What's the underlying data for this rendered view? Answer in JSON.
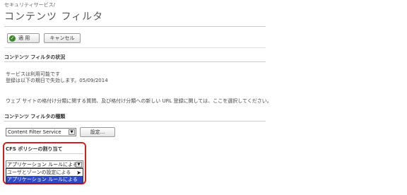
{
  "breadcrumb": "セキュリティサービス/",
  "page_title": "コンテンツ フィルタ",
  "toolbar": {
    "apply_label": "適 用",
    "cancel_label": "キャンセル"
  },
  "status_section": {
    "header": "コンテンツ フィルタの状況",
    "line1": "サービスは利用可能です",
    "line2": "登録は以下の期日で失効します。05/09/2014",
    "info_link": "ウェブ サイトの格付け分類に関する質問、及び格付け分類への新しい URL 登録に関しては、ここを選択してください。"
  },
  "type_section": {
    "header": "コンテンツ フィルタの種類",
    "selected_value": "Content Filter Service",
    "settings_button": "設定..."
  },
  "cfs_policy": {
    "header": "CFS ポリシーの割り当て",
    "selected_value": "アプリケーション ルールによる",
    "options": [
      "ユーザとゾーンの設定による",
      "アプリケーション ルールによる"
    ]
  },
  "colors": {
    "highlight": "#d02020",
    "selected_option_bg": "#2f49c9",
    "apply_icon": "#3a8a2a"
  },
  "icons": {
    "apply": "check-circle-icon",
    "dropdown": "chevron-down-icon",
    "cursor": "mouse-pointer-icon"
  }
}
